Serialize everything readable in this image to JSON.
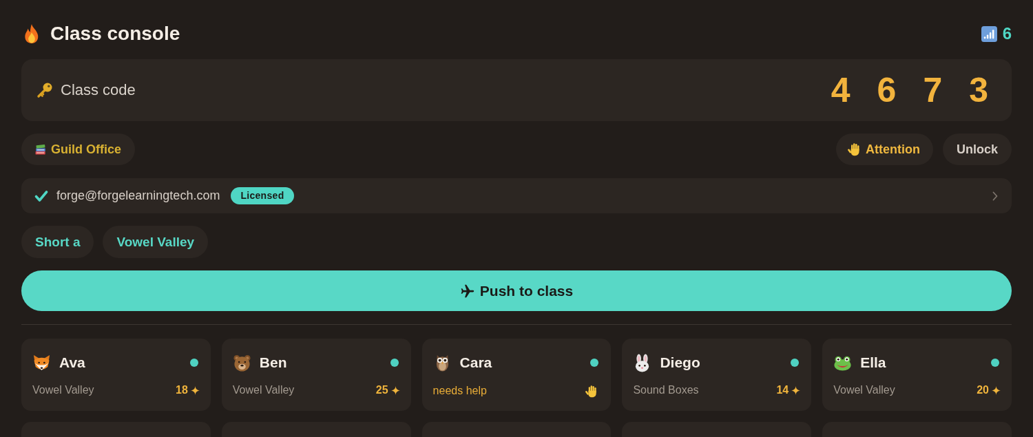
{
  "header": {
    "title": "Class console",
    "connected_count": "6"
  },
  "class_code": {
    "label": "Class code",
    "digits": [
      "4",
      "6",
      "7",
      "3"
    ]
  },
  "room_button": {
    "label": "Guild Office"
  },
  "actions": [
    {
      "label": "Attention",
      "kind": "alert"
    },
    {
      "label": "Unlock",
      "kind": "plain"
    }
  ],
  "account": {
    "verified": true,
    "email": "forge@forgelearningtech.com",
    "badge": "Licensed"
  },
  "lesson_tags": [
    "Short a",
    "Vowel Valley"
  ],
  "push_button": {
    "label": "Push to class"
  },
  "students": [
    {
      "kind": "working",
      "avatar": {
        "kind": "fox"
      },
      "name": "Ava",
      "online": true,
      "lesson": "Vowel Valley",
      "points": "18"
    },
    {
      "kind": "working",
      "avatar": {
        "kind": "bear"
      },
      "name": "Ben",
      "online": true,
      "lesson": "Vowel Valley",
      "points": "25"
    },
    {
      "kind": "needs_help",
      "avatar": {
        "kind": "owl"
      },
      "name": "Cara",
      "online": true,
      "status": "needs help"
    },
    {
      "kind": "working",
      "avatar": {
        "kind": "rabbit"
      },
      "name": "Diego",
      "online": true,
      "lesson": "Sound Boxes",
      "points": "14"
    },
    {
      "kind": "working",
      "avatar": {
        "kind": "frog"
      },
      "name": "Ella",
      "online": true,
      "lesson": "Vowel Valley",
      "points": "20"
    },
    {
      "kind": "partial"
    },
    {
      "kind": "partial"
    },
    {
      "kind": "partial"
    },
    {
      "kind": "partial"
    },
    {
      "kind": "partial"
    }
  ]
}
